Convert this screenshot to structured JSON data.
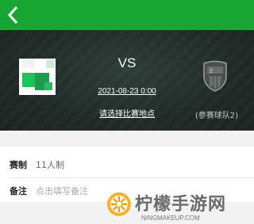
{
  "header": {
    "back_icon": "chevron-left-icon",
    "color": "#19a532"
  },
  "match": {
    "vs": "VS",
    "datetime": "2021-08-23 0:00",
    "venue_prompt": "请选择比赛地点",
    "team_b_name": "(参赛球队2)"
  },
  "details": [
    {
      "key": "赛制",
      "value": "11人制"
    },
    {
      "key": "备注",
      "placeholder": "点击填写备注"
    }
  ],
  "watermark": {
    "text": "柠檬手游网",
    "sub": "NINGMAKEUP.COM"
  }
}
